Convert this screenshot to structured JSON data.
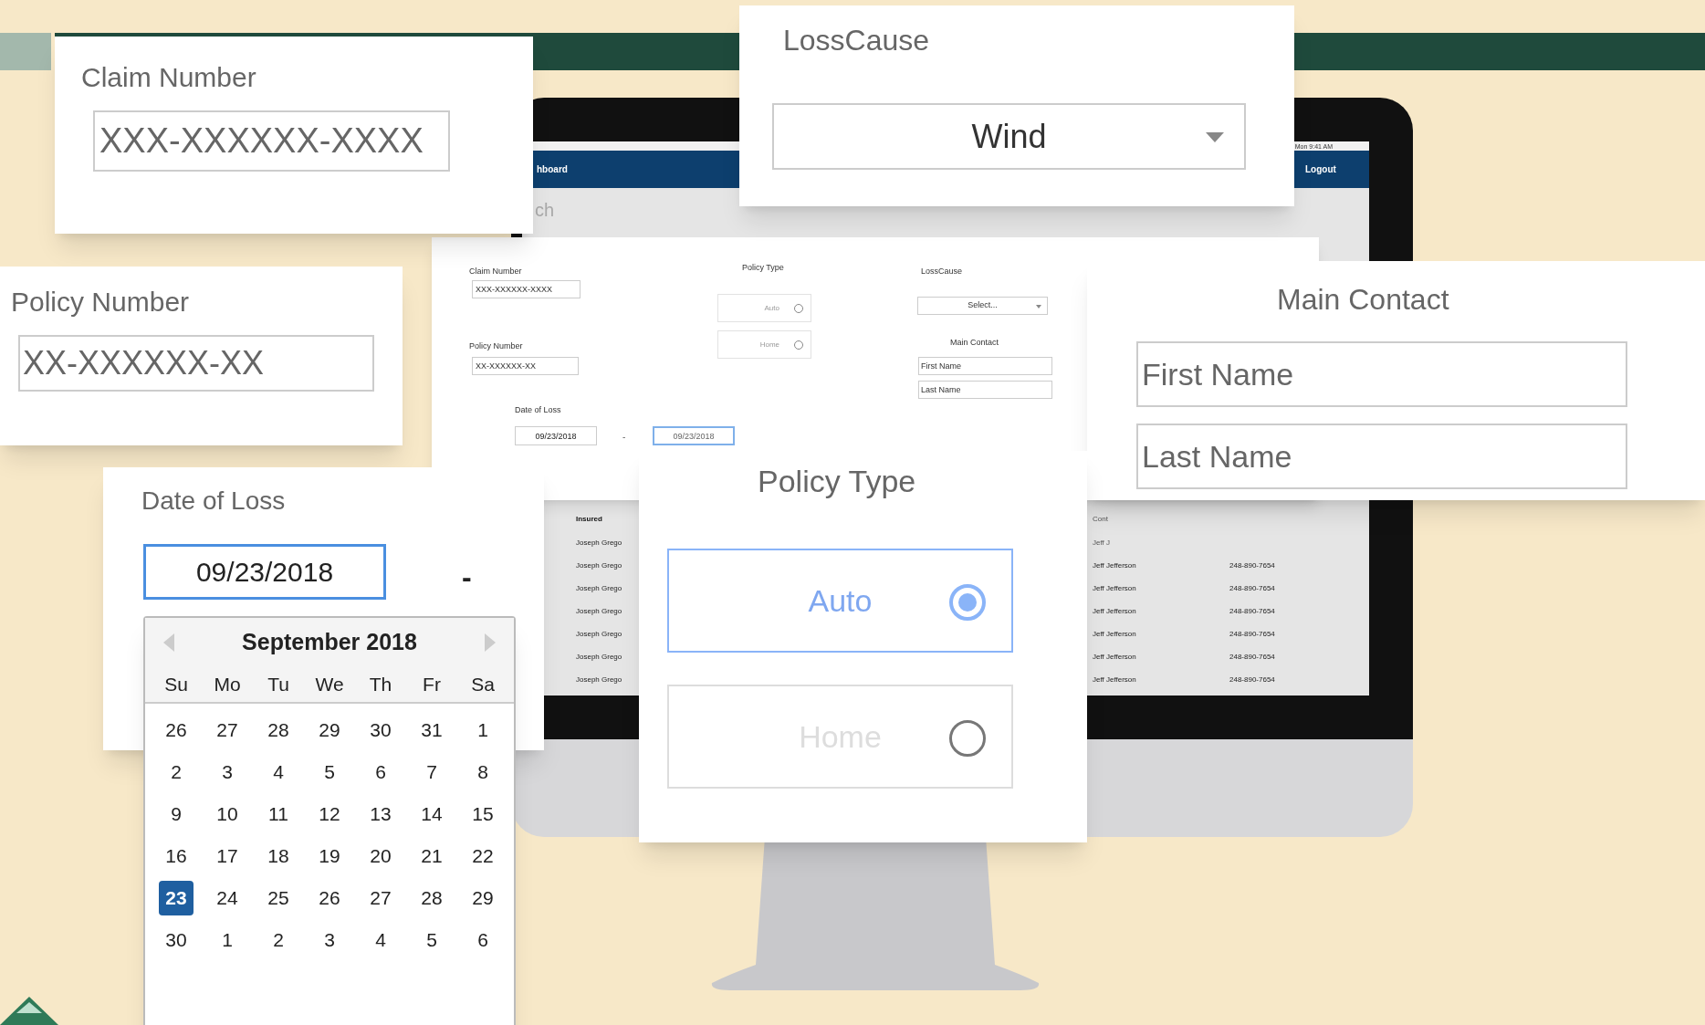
{
  "monitor": {
    "menubar_clock": "Mon 9:41 AM",
    "nav_title": "hboard",
    "logout": "Logout",
    "page_heading": "ch",
    "table": {
      "columns": [
        "Insured",
        "Cont"
      ],
      "rows": [
        {
          "insured": "Joseph Grego",
          "contact": "Jeff J"
        },
        {
          "insured": "Joseph Grego",
          "contact": "Jeff Jefferson",
          "phone": "248-890-7654"
        },
        {
          "insured": "Joseph Grego",
          "contact": "Jeff Jefferson",
          "phone": "248-890-7654"
        },
        {
          "insured": "Joseph Grego",
          "contact": "Jeff Jefferson",
          "phone": "248-890-7654"
        },
        {
          "insured": "Joseph Grego",
          "contact": "Jeff Jefferson",
          "phone": "248-890-7654"
        },
        {
          "insured": "Joseph Grego",
          "contact": "Jeff Jefferson",
          "phone": "248-890-7654"
        },
        {
          "insured": "Joseph Grego",
          "contact": "Jeff Jefferson",
          "phone": "248-890-7654"
        }
      ]
    }
  },
  "search_form": {
    "claim_number": {
      "label": "Claim Number",
      "placeholder": "XXX-XXXXXX-XXXX"
    },
    "policy_number": {
      "label": "Policy Number",
      "placeholder": "XX-XXXXXX-XX"
    },
    "date_of_loss": {
      "label": "Date of Loss",
      "from": {
        "value": "09/23/2018",
        "focused": false
      },
      "separator": "-",
      "to": {
        "value": "09/23/2018",
        "focused": true
      }
    },
    "policy_type": {
      "label": "Policy Type",
      "options": [
        {
          "label": "Auto",
          "selected": false
        },
        {
          "label": "Home",
          "selected": false
        }
      ]
    },
    "loss_cause": {
      "label": "LossCause",
      "value": "Select..."
    },
    "main_contact": {
      "label": "Main Contact",
      "fields": [
        {
          "placeholder": "First Name"
        },
        {
          "placeholder": "Last Name"
        }
      ]
    }
  },
  "callouts": {
    "claim_number": {
      "label": "Claim Number",
      "placeholder": "XXX-XXXXXX-XXXX"
    },
    "loss_cause": {
      "label": "LossCause",
      "value": "Wind"
    },
    "policy_number": {
      "label": "Policy Number",
      "placeholder": "XX-XXXXXX-XX"
    },
    "main_contact": {
      "label": "Main Contact",
      "fields": [
        {
          "placeholder": "First Name"
        },
        {
          "placeholder": "Last Name"
        }
      ]
    },
    "date_of_loss": {
      "label": "Date of Loss",
      "value": "09/23/2018",
      "focused": true,
      "separator": "-"
    },
    "calendar": {
      "month": "September 2018",
      "weekdays": [
        "Su",
        "Mo",
        "Tu",
        "We",
        "Th",
        "Fr",
        "Sa"
      ],
      "weeks": [
        [
          {
            "day": "26",
            "selected": false
          },
          {
            "day": "27",
            "selected": false
          },
          {
            "day": "28",
            "selected": false
          },
          {
            "day": "29",
            "selected": false
          },
          {
            "day": "30",
            "selected": false
          },
          {
            "day": "31",
            "selected": false
          },
          {
            "day": "1",
            "selected": false
          }
        ],
        [
          {
            "day": "2",
            "selected": false
          },
          {
            "day": "3",
            "selected": false
          },
          {
            "day": "4",
            "selected": false
          },
          {
            "day": "5",
            "selected": false
          },
          {
            "day": "6",
            "selected": false
          },
          {
            "day": "7",
            "selected": false
          },
          {
            "day": "8",
            "selected": false
          }
        ],
        [
          {
            "day": "9",
            "selected": false
          },
          {
            "day": "10",
            "selected": false
          },
          {
            "day": "11",
            "selected": false
          },
          {
            "day": "12",
            "selected": false
          },
          {
            "day": "13",
            "selected": false
          },
          {
            "day": "14",
            "selected": false
          },
          {
            "day": "15",
            "selected": false
          }
        ],
        [
          {
            "day": "16",
            "selected": false
          },
          {
            "day": "17",
            "selected": false
          },
          {
            "day": "18",
            "selected": false
          },
          {
            "day": "19",
            "selected": false
          },
          {
            "day": "20",
            "selected": false
          },
          {
            "day": "21",
            "selected": false
          },
          {
            "day": "22",
            "selected": false
          }
        ],
        [
          {
            "day": "23",
            "selected": true
          },
          {
            "day": "24",
            "selected": false
          },
          {
            "day": "25",
            "selected": false
          },
          {
            "day": "26",
            "selected": false
          },
          {
            "day": "27",
            "selected": false
          },
          {
            "day": "28",
            "selected": false
          },
          {
            "day": "29",
            "selected": false
          }
        ],
        [
          {
            "day": "30",
            "selected": false
          },
          {
            "day": "1",
            "selected": false
          },
          {
            "day": "2",
            "selected": false
          },
          {
            "day": "3",
            "selected": false
          },
          {
            "day": "4",
            "selected": false
          },
          {
            "day": "5",
            "selected": false
          },
          {
            "day": "6",
            "selected": false
          }
        ]
      ]
    },
    "policy_type": {
      "label": "Policy Type",
      "options": [
        {
          "label": "Auto",
          "selected": true
        },
        {
          "label": "Home",
          "selected": false
        }
      ]
    }
  }
}
